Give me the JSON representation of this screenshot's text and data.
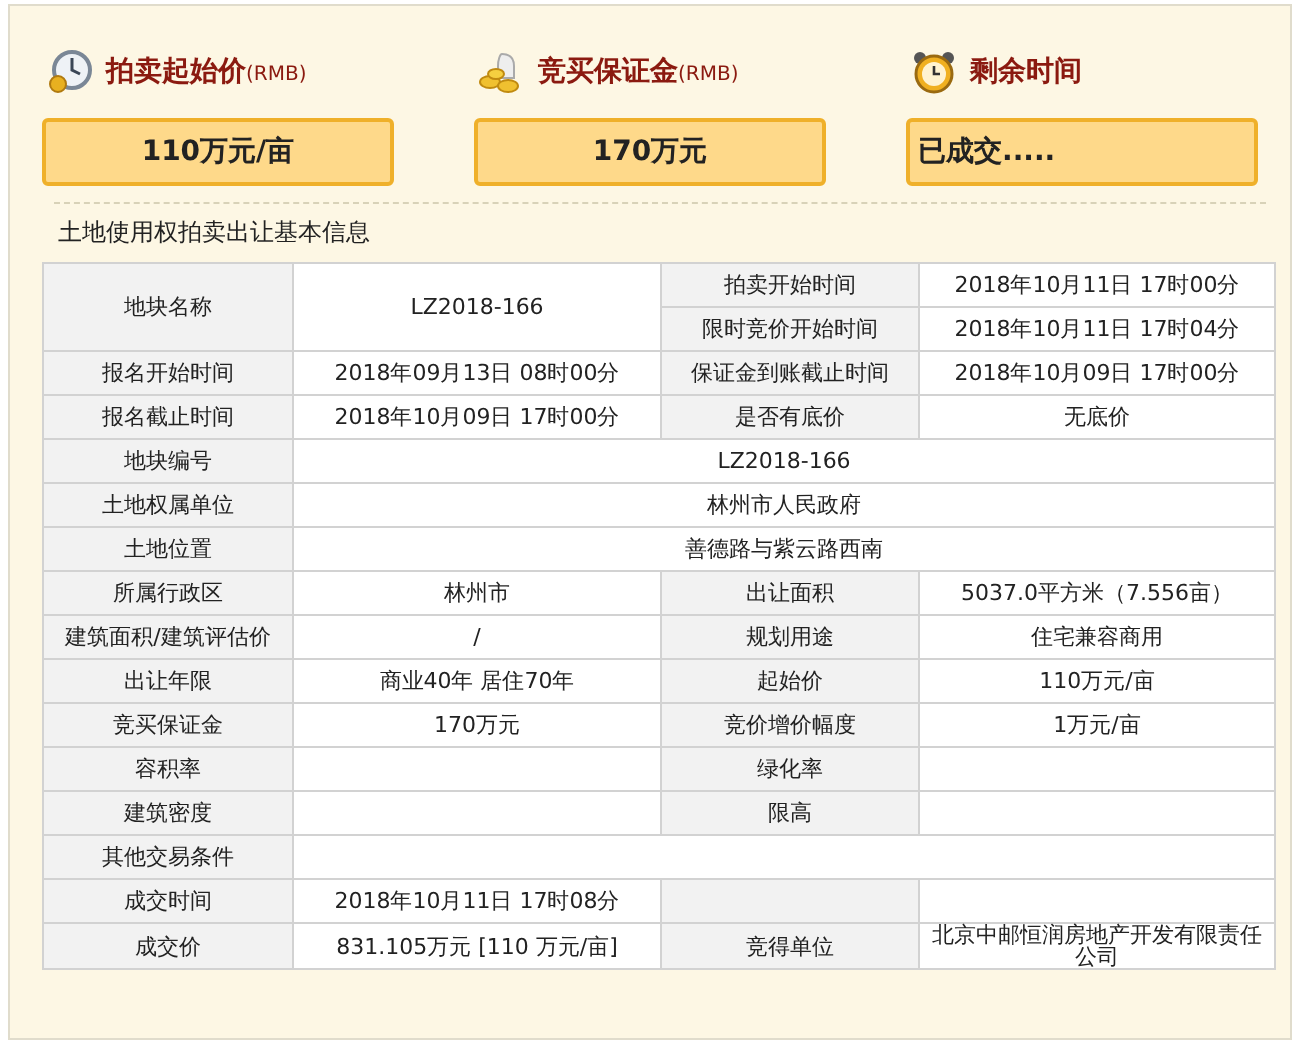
{
  "summary": [
    {
      "kind": "clock",
      "label": "拍卖起始价",
      "unit": "(RMB)",
      "value": "110万元/亩"
    },
    {
      "kind": "coins",
      "label": "竞买保证金",
      "unit": "(RMB)",
      "value": "170万元"
    },
    {
      "kind": "alarm",
      "label": "剩余时间",
      "value": "已成交....."
    }
  ],
  "section_title": "土地使用权拍卖出让基本信息",
  "table": {
    "rows": [
      [
        {
          "kind": "label",
          "text": "地块名称",
          "rowspan": 2
        },
        {
          "kind": "value",
          "text": "LZ2018-166",
          "rowspan": 2
        },
        {
          "kind": "label",
          "text": "拍卖开始时间"
        },
        {
          "kind": "value",
          "text": "2018年10月11日 17时00分"
        }
      ],
      [
        {
          "kind": "label",
          "text": "限时竞价开始时间"
        },
        {
          "kind": "value",
          "text": "2018年10月11日 17时04分"
        }
      ],
      [
        {
          "kind": "label",
          "text": "报名开始时间"
        },
        {
          "kind": "value",
          "text": "2018年09月13日 08时00分"
        },
        {
          "kind": "label",
          "text": "保证金到账截止时间"
        },
        {
          "kind": "value",
          "text": "2018年10月09日 17时00分"
        }
      ],
      [
        {
          "kind": "label",
          "text": "报名截止时间"
        },
        {
          "kind": "value",
          "text": "2018年10月09日 17时00分"
        },
        {
          "kind": "label",
          "text": "是否有底价"
        },
        {
          "kind": "value",
          "text": "无底价"
        }
      ],
      [
        {
          "kind": "label",
          "text": "地块编号"
        },
        {
          "kind": "value",
          "text": "LZ2018-166",
          "colspan": 3
        }
      ],
      [
        {
          "kind": "label",
          "text": "土地权属单位"
        },
        {
          "kind": "value",
          "text": "林州市人民政府",
          "colspan": 3
        }
      ],
      [
        {
          "kind": "label",
          "text": "土地位置"
        },
        {
          "kind": "value",
          "text": "善德路与紫云路西南",
          "colspan": 3
        }
      ],
      [
        {
          "kind": "label",
          "text": "所属行政区"
        },
        {
          "kind": "value",
          "text": "林州市"
        },
        {
          "kind": "label",
          "text": "出让面积"
        },
        {
          "kind": "value",
          "text": "5037.0平方米（7.556亩）"
        }
      ],
      [
        {
          "kind": "label",
          "text": "建筑面积/建筑评估价"
        },
        {
          "kind": "value",
          "text": "/"
        },
        {
          "kind": "label",
          "text": "规划用途"
        },
        {
          "kind": "value",
          "text": "住宅兼容商用"
        }
      ],
      [
        {
          "kind": "label",
          "text": "出让年限"
        },
        {
          "kind": "value",
          "text": "商业40年 居住70年"
        },
        {
          "kind": "label",
          "text": "起始价"
        },
        {
          "kind": "value",
          "text": "110万元/亩"
        }
      ],
      [
        {
          "kind": "label",
          "text": "竞买保证金"
        },
        {
          "kind": "value",
          "text": "170万元"
        },
        {
          "kind": "label",
          "text": "竞价增价幅度"
        },
        {
          "kind": "value",
          "text": "1万元/亩"
        }
      ],
      [
        {
          "kind": "label",
          "text": "容积率"
        },
        {
          "kind": "value"
        },
        {
          "kind": "label",
          "text": "绿化率"
        },
        {
          "kind": "value"
        }
      ],
      [
        {
          "kind": "label",
          "text": "建筑密度"
        },
        {
          "kind": "value"
        },
        {
          "kind": "label",
          "text": "限高"
        },
        {
          "kind": "value"
        }
      ],
      [
        {
          "kind": "label",
          "text": "其他交易条件"
        },
        {
          "kind": "value",
          "colspan": 3
        }
      ],
      [
        {
          "kind": "label",
          "text": "成交时间"
        },
        {
          "kind": "value",
          "text": "2018年10月11日 17时08分"
        },
        {
          "kind": "label"
        },
        {
          "kind": "value"
        }
      ],
      [
        {
          "kind": "label",
          "text": "成交价"
        },
        {
          "kind": "value",
          "text": "831.105万元 [110 万元/亩]"
        },
        {
          "kind": "label",
          "text": "竞得单位"
        },
        {
          "kind": "value",
          "text": "北京中邮恒润房地产开发有限责任公司"
        }
      ]
    ]
  }
}
